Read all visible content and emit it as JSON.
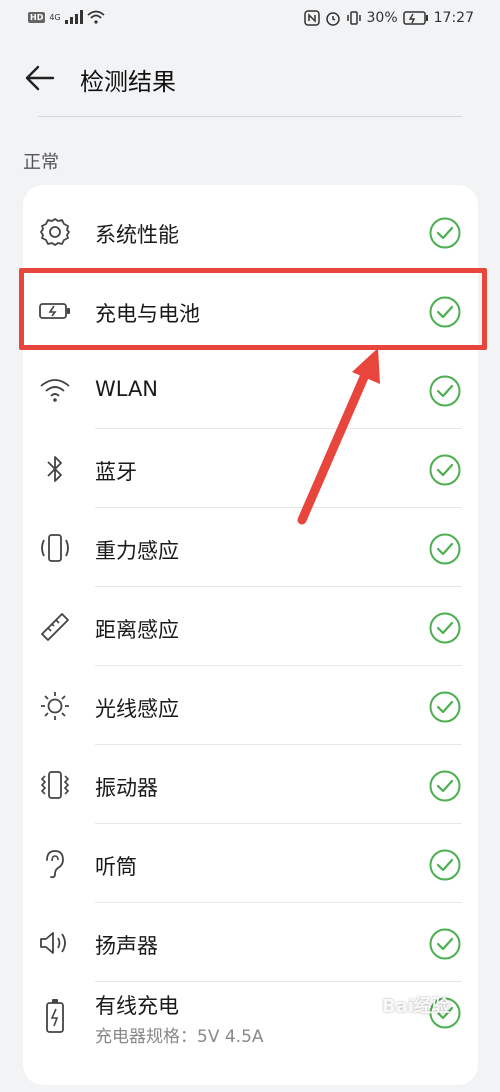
{
  "statusbar": {
    "left_badge": "HD",
    "network": "4G",
    "battery_percent": "30%",
    "time": "17:27"
  },
  "header": {
    "title": "检测结果"
  },
  "section": {
    "title": "正常"
  },
  "items": [
    {
      "label": "系统性能",
      "icon": "gear-icon",
      "status": "ok"
    },
    {
      "label": "充电与电池",
      "icon": "battery-icon",
      "status": "ok"
    },
    {
      "label": "WLAN",
      "icon": "wifi-icon",
      "status": "ok"
    },
    {
      "label": "蓝牙",
      "icon": "bluetooth-icon",
      "status": "ok"
    },
    {
      "label": "重力感应",
      "icon": "gravity-sensor-icon",
      "status": "ok"
    },
    {
      "label": "距离感应",
      "icon": "ruler-icon",
      "status": "ok"
    },
    {
      "label": "光线感应",
      "icon": "sun-icon",
      "status": "ok"
    },
    {
      "label": "振动器",
      "icon": "vibration-icon",
      "status": "ok"
    },
    {
      "label": "听筒",
      "icon": "ear-icon",
      "status": "ok"
    },
    {
      "label": "扬声器",
      "icon": "speaker-icon",
      "status": "ok"
    },
    {
      "label": "有线充电",
      "sublabel": "充电器规格：5V 4.5A",
      "icon": "charging-icon",
      "status": "ok"
    }
  ],
  "colors": {
    "accent_green": "#4caf50",
    "highlight_red": "#e8453c"
  },
  "watermark": "Bai经验"
}
